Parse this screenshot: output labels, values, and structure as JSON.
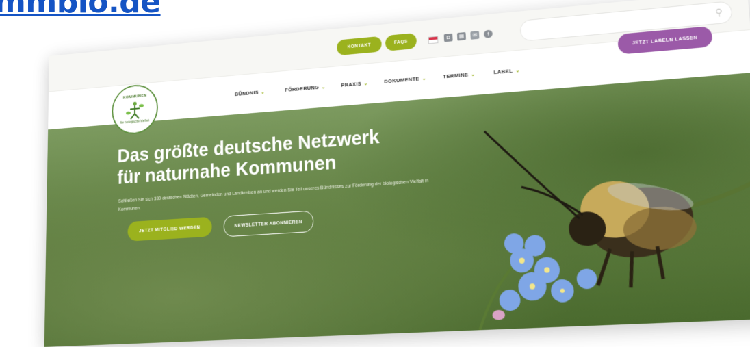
{
  "banner": {
    "text": "mmbio.de"
  },
  "topbar": {
    "kontakt_label": "KONTAKT",
    "faqs_label": "FAQS",
    "social_icons": [
      "instagram-icon",
      "calendar-icon",
      "mail-icon",
      "facebook-icon"
    ]
  },
  "nav": {
    "items": [
      {
        "label": "BÜNDNIS"
      },
      {
        "label": "FÖRDERUNG"
      },
      {
        "label": "PRAXIS"
      },
      {
        "label": "DOKUMENTE"
      },
      {
        "label": "TERMINE"
      },
      {
        "label": "LABEL"
      }
    ],
    "cta_label": "JETZT LABELN LASSEN"
  },
  "logo": {
    "top_text": "KOMMUNEN",
    "bottom_text": "für biologische Vielfalt"
  },
  "hero": {
    "title_line1": "Das größte deutsche Netzwerk",
    "title_line2": "für naturnahe Kommunen",
    "subtitle": "Schließen Sie sich 330 deutschen Städten, Gemeinden und Landkreisen an und werden Sie Teil unseres Bündnisses zur Förderung der biologischen Vielfalt in Kommunen.",
    "member_button": "JETZT MITGLIED WERDEN",
    "newsletter_button": "NEWSLETTER ABONNIEREN"
  },
  "colors": {
    "accent_green": "#9bb21e",
    "cta_purple": "#9b5aa8",
    "link_blue": "#1554c4"
  }
}
